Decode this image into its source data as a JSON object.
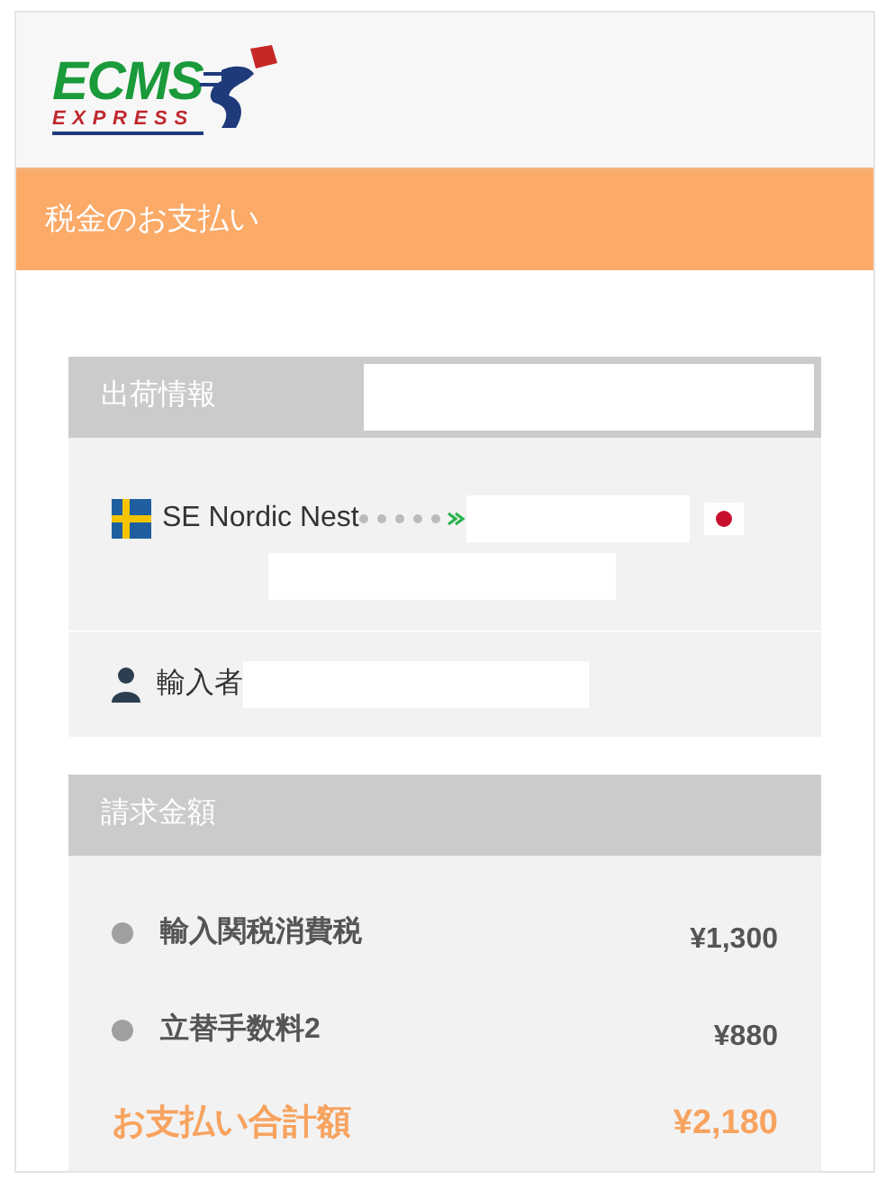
{
  "logo": {
    "wordmark": "ECMS",
    "tagline": "EXPRESS"
  },
  "title": "税金のお支払い",
  "shipment": {
    "heading": "出荷情報",
    "sender": "SE Nordic Nest",
    "importer_label": "輸入者"
  },
  "billing": {
    "heading": "請求金額",
    "items": [
      {
        "label": "輸入関税消費税",
        "amount": "¥1,300"
      },
      {
        "label": "立替手数料2",
        "amount": "¥880"
      }
    ],
    "total_label": "お支払い合計額",
    "total_amount": "¥2,180"
  }
}
